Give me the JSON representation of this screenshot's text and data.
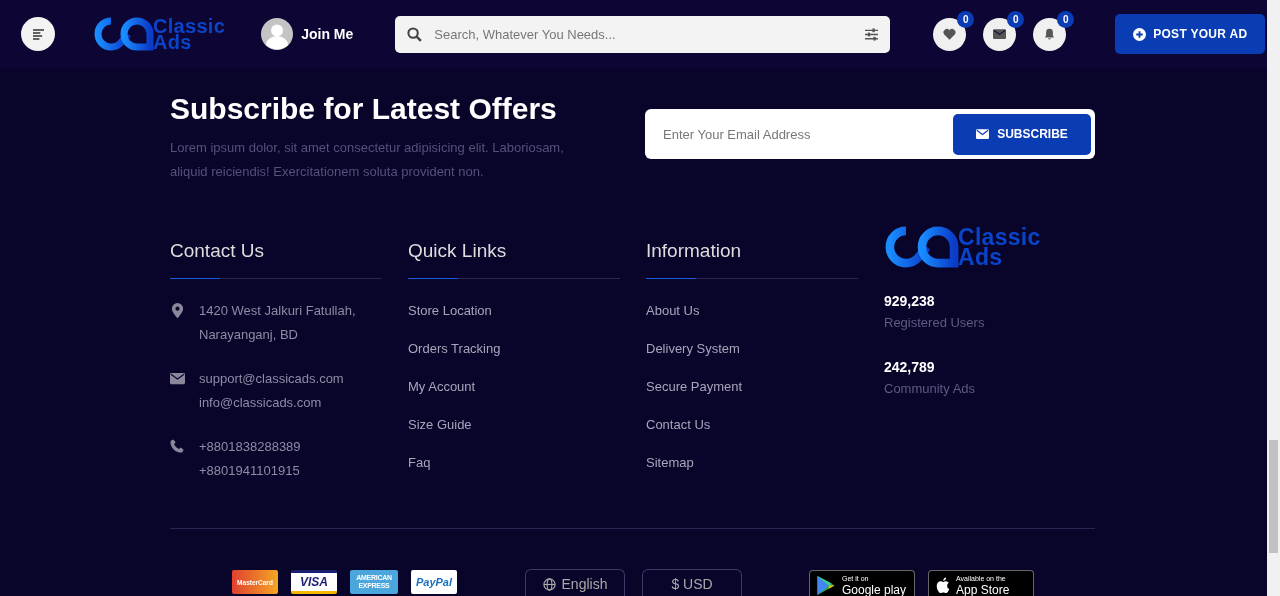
{
  "header": {
    "logo": {
      "line_1": "Classic",
      "line_2": "Ads"
    },
    "join_label": "Join Me",
    "search": {
      "placeholder": "Search, Whatever You Needs..."
    },
    "actions": [
      {
        "kind": "heart",
        "count": "0"
      },
      {
        "kind": "mail",
        "count": "0"
      },
      {
        "kind": "bell",
        "count": "0"
      }
    ],
    "post_button": "POST YOUR AD"
  },
  "subscribe": {
    "title": "Subscribe for Latest Offers",
    "text": "Lorem ipsum dolor, sit amet consectetur adipisicing elit. Laboriosam, aliquid reiciendis! Exercitationem soluta provident non.",
    "email": {
      "placeholder": "Enter Your Email Address"
    },
    "button": "SUBSCRIBE"
  },
  "contact": {
    "title": "Contact Us",
    "items": [
      {
        "kind": "location",
        "lines": [
          "1420 West Jalkuri Fatullah,",
          "Narayanganj, BD"
        ]
      },
      {
        "kind": "mail",
        "lines": [
          "support@classicads.com",
          "info@classicads.com"
        ]
      },
      {
        "kind": "phone",
        "lines": [
          "+8801838288389",
          "+8801941101915"
        ]
      }
    ]
  },
  "quick_links": {
    "title": "Quick Links",
    "links": [
      "Store Location",
      "Orders Tracking",
      "My Account",
      "Size Guide",
      "Faq"
    ]
  },
  "information": {
    "title": "Information",
    "links": [
      "About Us",
      "Delivery System",
      "Secure Payment",
      "Contact Us",
      "Sitemap"
    ]
  },
  "brand": {
    "logo": {
      "line_1": "Classic",
      "line_2": "Ads"
    },
    "stats": [
      {
        "value": "929,238",
        "label": "Registered Users"
      },
      {
        "value": "242,789",
        "label": "Community Ads"
      }
    ]
  },
  "bottom": {
    "cards": [
      {
        "kind": "mastercard",
        "label": "MasterCard"
      },
      {
        "kind": "visa",
        "label": "VISA"
      },
      {
        "kind": "amex",
        "label": "AMERICAN EXPRESS"
      },
      {
        "kind": "paypal",
        "label": "PayPal"
      }
    ],
    "language": "English",
    "currency_symbol": "$",
    "currency": "USD",
    "stores": [
      {
        "kind": "google",
        "small": "Get it on",
        "big": "Google play"
      },
      {
        "kind": "apple",
        "small": "Available on the",
        "big": "App Store"
      }
    ]
  }
}
